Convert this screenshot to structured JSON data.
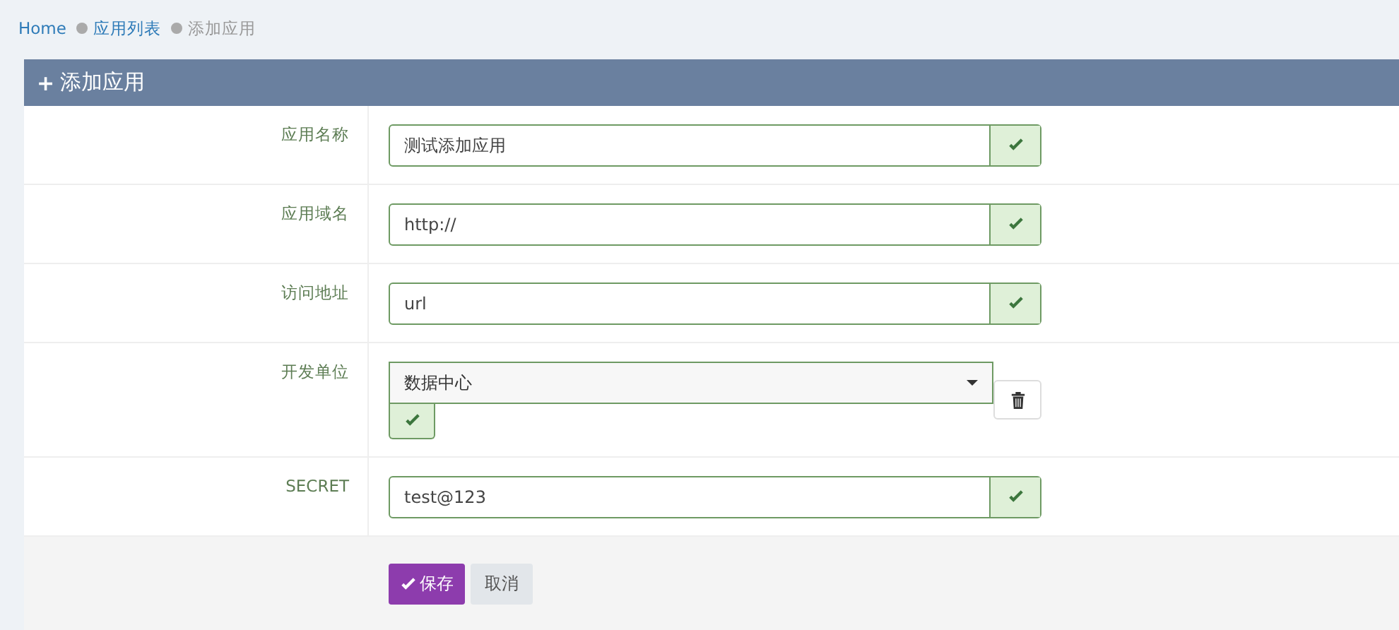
{
  "breadcrumb": [
    {
      "label": "Home",
      "kind": "link"
    },
    {
      "label": "应用列表",
      "kind": "link"
    },
    {
      "label": "添加应用",
      "kind": "current"
    }
  ],
  "panel": {
    "icon": "+",
    "title": "添加应用"
  },
  "fields": [
    {
      "label": "应用名称",
      "kind": "text",
      "value": "测试添加应用",
      "valid": true
    },
    {
      "label": "应用域名",
      "kind": "text",
      "value": "http://",
      "valid": true
    },
    {
      "label": "访问地址",
      "kind": "text",
      "value": "url",
      "valid": true
    },
    {
      "label": "开发单位",
      "kind": "select",
      "value": "数据中心",
      "valid": true
    },
    {
      "label": "SECRET",
      "kind": "text",
      "value": "test@123",
      "valid": true
    }
  ],
  "buttons": [
    {
      "label": "保存",
      "kind": "primary"
    },
    {
      "label": "取消",
      "kind": "default"
    }
  ]
}
